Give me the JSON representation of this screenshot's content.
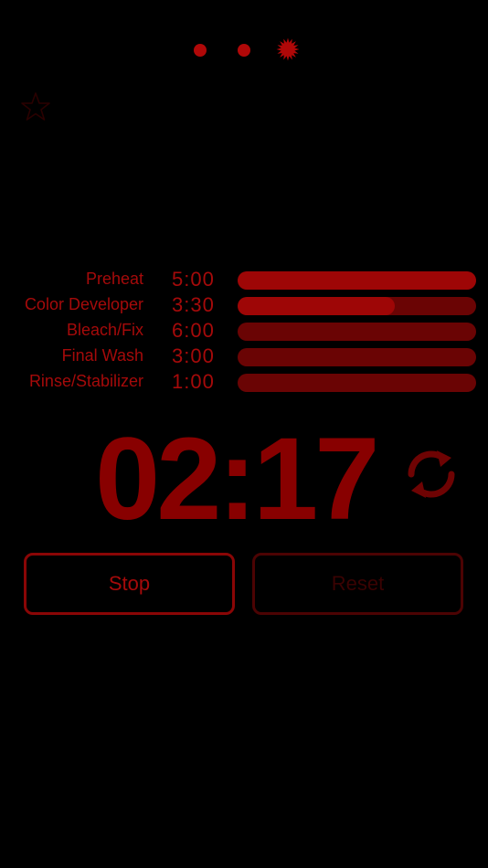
{
  "pager": {
    "pages": 3,
    "current_page": 3
  },
  "favorite": {
    "icon": "star-outline-icon",
    "active": false
  },
  "steps": [
    {
      "name": "Preheat",
      "time": "5:00",
      "progress": 1.0
    },
    {
      "name": "Color Developer",
      "time": "3:30",
      "progress": 0.66
    },
    {
      "name": "Bleach/Fix",
      "time": "6:00",
      "progress": 0.0
    },
    {
      "name": "Final Wash",
      "time": "3:00",
      "progress": 0.0
    },
    {
      "name": "Rinse/Stabilizer",
      "time": "1:00",
      "progress": 0.0
    }
  ],
  "timer": {
    "display": "02:17",
    "reload_icon": "reload-icon"
  },
  "buttons": {
    "stop_label": "Stop",
    "reset_label": "Reset",
    "reset_enabled": false
  },
  "colors": {
    "background": "#000000",
    "accent": "#a50a0a",
    "bar_track": "#6a0404",
    "bar_fill": "#9e0606",
    "timer": "#880000",
    "disabled": "#3a0202"
  }
}
